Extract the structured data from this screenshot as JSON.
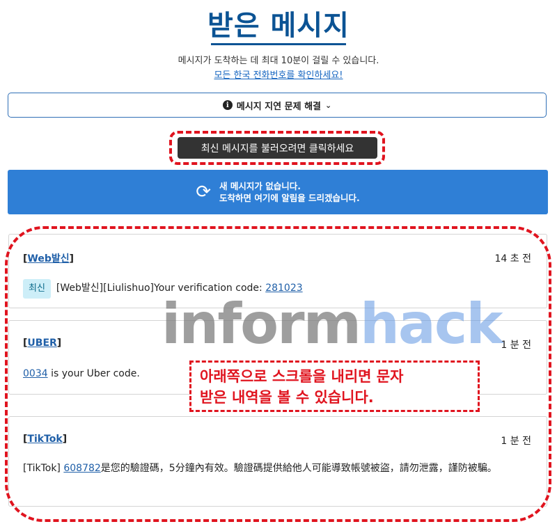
{
  "header": {
    "title": "받은 메시지",
    "subtitle": "메시지가 도착하는 데 최대 10분이 걸릴 수 있습니다.",
    "link": "모든 한국 전화번호를 확인하세요!"
  },
  "trouble_button": {
    "label": "메시지 지연 문제 해결",
    "icon": "info-icon",
    "chevron": "chevron-down-icon"
  },
  "refresh_button": {
    "label": "최신 메시지를 불러오려면 클릭하세요"
  },
  "banner": {
    "line1": "새 메시지가 없습니다.",
    "line2": "도착하면 여기에 알림을 드리겠습니다.",
    "icon": "sync-icon",
    "color": "#2f7fd6"
  },
  "messages": [
    {
      "sender": "Web발신",
      "time": "14 초 전",
      "badge": "최신",
      "text_before": "[Web발신][Liulishuo]Your verification code: ",
      "code": "281023",
      "text_after": ""
    },
    {
      "sender": "UBER",
      "time": "1 분 전",
      "text_before": "",
      "code": "0034",
      "text_after": " is your Uber code."
    },
    {
      "sender": "TikTok",
      "time": "1 분 전",
      "text_before": "[TikTok] ",
      "code": "608782",
      "text_after": "是您的驗證碼，5分鐘內有效。驗證碼提供給他人可能導致帳號被盜，請勿泄露，謹防被騙。"
    }
  ],
  "watermark": {
    "part1": "inform",
    "part2": "hack"
  },
  "annotation": {
    "line1": "아래쪽으로 스크롤을 내리면 문자",
    "line2": "받은 내역을 볼 수 있습니다."
  },
  "colors": {
    "title": "#0b5394",
    "highlight": "#e0141f",
    "link": "#1f5fa8"
  }
}
